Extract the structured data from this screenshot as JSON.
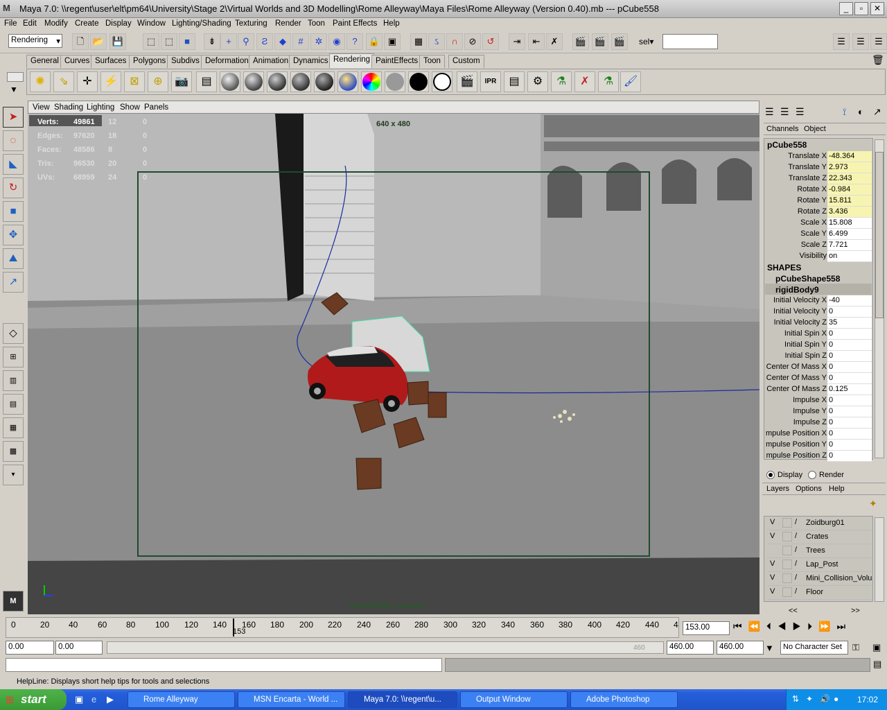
{
  "window": {
    "title": "Maya 7.0: \\\\regent\\user\\elt\\pm64\\University\\Stage 2\\Virtual Worlds and 3D Modelling\\Rome Alleyway\\Maya Files\\Rome Alleyway (Version 0.40).mb   ---   pCube558",
    "app_icon": "M",
    "min": "_",
    "max": "▫",
    "close": "✕"
  },
  "menu": [
    "File",
    "Edit",
    "Modify",
    "Create",
    "Display",
    "Window",
    "Lighting/Shading",
    "Texturing",
    "Render",
    "Toon",
    "Paint Effects",
    "Help"
  ],
  "status": {
    "menuset": "Rendering",
    "sel_label": "sel▾",
    "sel_value": ""
  },
  "shelf_tabs": [
    "General",
    "Curves",
    "Surfaces",
    "Polygons",
    "Subdivs",
    "Deformation",
    "Animation",
    "Dynamics",
    "Rendering",
    "PaintEffects",
    "Toon",
    "Custom"
  ],
  "active_shelf": "Rendering",
  "panel_menu": [
    "View",
    "Shading",
    "Lighting",
    "Show",
    "Panels"
  ],
  "hud": {
    "rows": [
      {
        "label": "Verts:",
        "a": "49861",
        "b": "12",
        "c": "0"
      },
      {
        "label": "Edges:",
        "a": "97620",
        "b": "18",
        "c": "0"
      },
      {
        "label": "Faces:",
        "a": "48586",
        "b": "8",
        "c": "0"
      },
      {
        "label": "Tris:",
        "a": "96530",
        "b": "20",
        "c": "0"
      },
      {
        "label": "UVs:",
        "a": "68959",
        "b": "24",
        "c": "0"
      }
    ],
    "resolution": "640 x 480",
    "camera": "DownStairs_Camera"
  },
  "channel_box": {
    "tabs": [
      "Channels",
      "Object"
    ],
    "object": "pCube558",
    "transform": [
      {
        "label": "Translate X",
        "value": "-48.364",
        "key": true
      },
      {
        "label": "Translate Y",
        "value": "2.973",
        "key": true
      },
      {
        "label": "Translate Z",
        "value": "22.343",
        "key": true
      },
      {
        "label": "Rotate X",
        "value": "-0.984",
        "key": true
      },
      {
        "label": "Rotate Y",
        "value": "15.811",
        "key": true
      },
      {
        "label": "Rotate Z",
        "value": "3.436",
        "key": true
      },
      {
        "label": "Scale X",
        "value": "15.808",
        "key": false
      },
      {
        "label": "Scale Y",
        "value": "6.499",
        "key": false
      },
      {
        "label": "Scale Z",
        "value": "7.721",
        "key": false
      },
      {
        "label": "Visibility",
        "value": "on",
        "key": false
      }
    ],
    "shapes_header": "SHAPES",
    "shape_name": "pCubeShape558",
    "rigid_name": "rigidBody9",
    "rigid": [
      {
        "label": "Initial Velocity X",
        "value": "-40"
      },
      {
        "label": "Initial Velocity Y",
        "value": "0"
      },
      {
        "label": "Initial Velocity Z",
        "value": "35"
      },
      {
        "label": "Initial Spin X",
        "value": "0"
      },
      {
        "label": "Initial Spin Y",
        "value": "0"
      },
      {
        "label": "Initial Spin Z",
        "value": "0"
      },
      {
        "label": "Center Of Mass X",
        "value": "0"
      },
      {
        "label": "Center Of Mass Y",
        "value": "0"
      },
      {
        "label": "Center Of Mass Z",
        "value": "0.125"
      },
      {
        "label": "Impulse X",
        "value": "0"
      },
      {
        "label": "Impulse Y",
        "value": "0"
      },
      {
        "label": "Impulse Z",
        "value": "0"
      },
      {
        "label": "mpulse Position X",
        "value": "0"
      },
      {
        "label": "mpulse Position Y",
        "value": "0"
      },
      {
        "label": "mpulse Position Z",
        "value": "0"
      }
    ]
  },
  "layer_editor": {
    "display": "Display",
    "render": "Render",
    "menu": [
      "Layers",
      "Options",
      "Help"
    ],
    "layers": [
      {
        "v": "V",
        "name": "Zoidburg01"
      },
      {
        "v": "V",
        "name": "Crates"
      },
      {
        "v": "",
        "name": "Trees"
      },
      {
        "v": "V",
        "name": "Lap_Post"
      },
      {
        "v": "V",
        "name": "Mini_Collision_Volume"
      },
      {
        "v": "V",
        "name": "Floor"
      }
    ],
    "scroll_left": "<<",
    "scroll_right": ">>"
  },
  "timeline": {
    "ticks": [
      "0",
      "20",
      "40",
      "60",
      "80",
      "100",
      "120",
      "140",
      "160",
      "180",
      "200",
      "220",
      "240",
      "260",
      "280",
      "300",
      "320",
      "340",
      "360",
      "380",
      "400",
      "420",
      "440",
      "4"
    ],
    "current_marker": "153",
    "current_frame": "153.00",
    "start": "0.00",
    "inner_start": "0.00",
    "inner_end": "460.00",
    "end": "460.00",
    "range_label": "460",
    "char_set": "No Character Set"
  },
  "helpline": "HelpLine: Displays short help tips for tools and selections",
  "taskbar": {
    "start": "start",
    "tasks": [
      "Rome Alleyway",
      "MSN Encarta - World ...",
      "Maya 7.0: \\\\regent\\u...",
      "Output Window",
      "Adobe Photoshop"
    ],
    "clock": "17:02"
  }
}
